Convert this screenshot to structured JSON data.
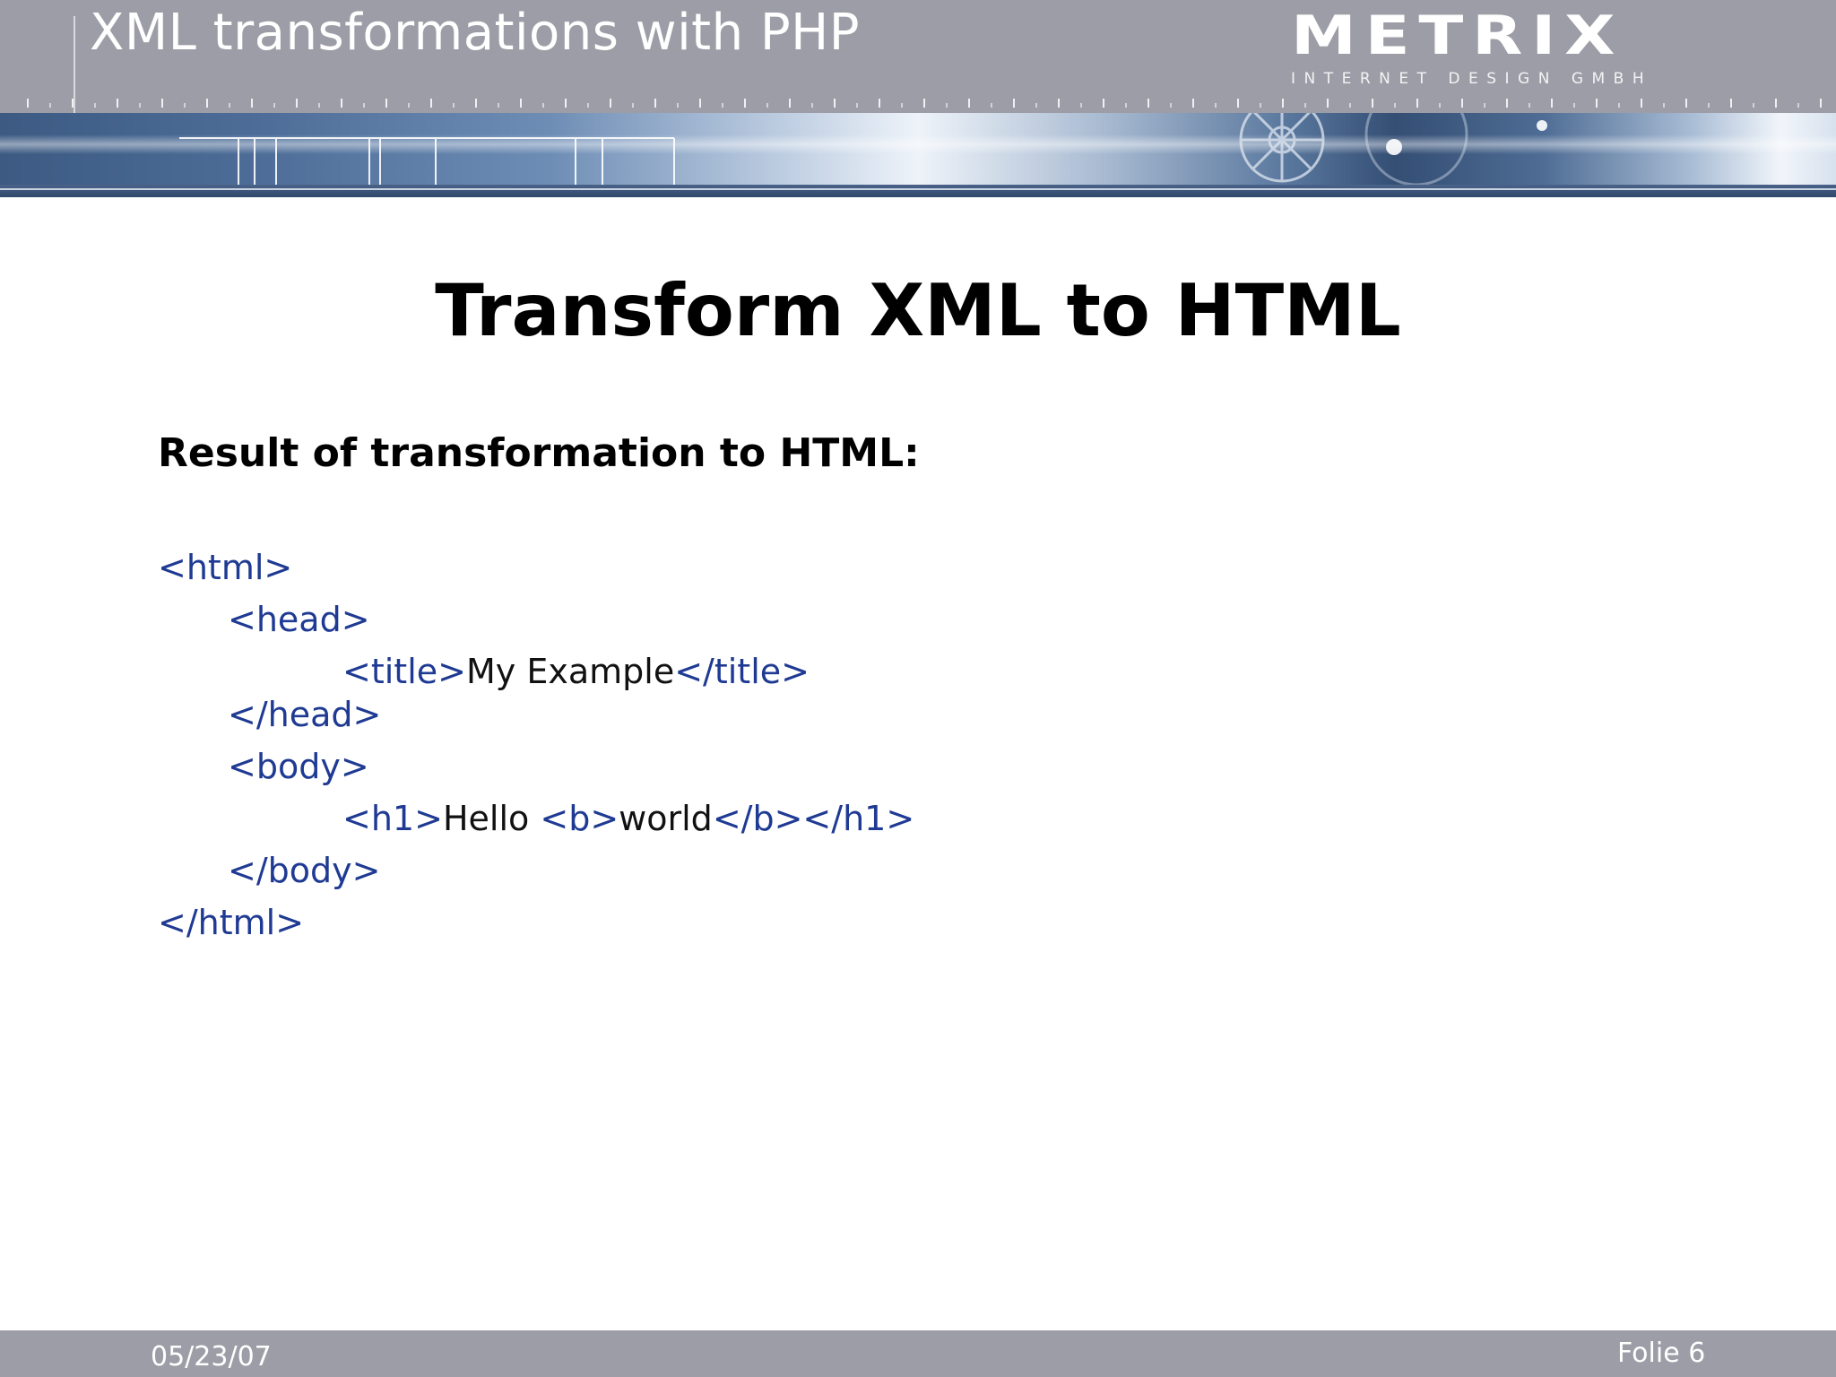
{
  "header": {
    "deck_title": "XML transformations with PHP",
    "logo_text": "METRIX",
    "logo_tagline": "INTERNET DESIGN GMBH"
  },
  "slide": {
    "title": "Transform XML to HTML",
    "subtitle": "Result of transformation to HTML:"
  },
  "code": {
    "html_open": "<html>",
    "head_open": "<head>",
    "title_open": "<title>",
    "title_text": "My Example",
    "title_close": "</title>",
    "head_close": "</head>",
    "body_open": "<body>",
    "h1_open": "<h1>",
    "h1_text": "Hello ",
    "b_open": "<b>",
    "b_text": "world",
    "b_close": "</b>",
    "h1_close": "</h1>",
    "body_close": "</body>",
    "html_close": "</html>"
  },
  "footer": {
    "date": "05/23/07",
    "page_label": "Folie 6"
  },
  "colors": {
    "header_gray": "#9d9da7",
    "tag_blue": "#1f3a93",
    "banner_blue": "#3c5a82"
  }
}
